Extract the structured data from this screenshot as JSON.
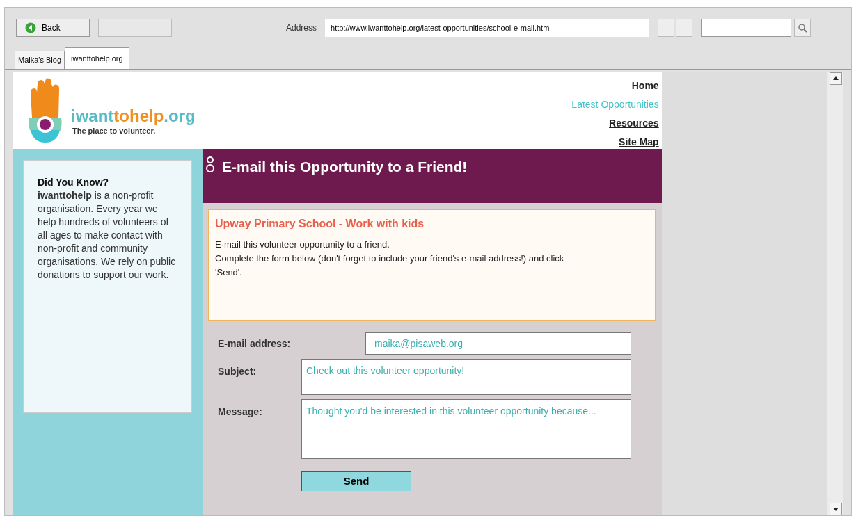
{
  "toolbar": {
    "back_button": "Back",
    "address_label": "Address",
    "address": "http://www.iwanttohelp.org/latest-opportunities/school-e-mail.html"
  },
  "tabs": [
    {
      "label": "Maika's Blog",
      "selected": false
    },
    {
      "label": "iwanttohelp.org",
      "selected": true
    }
  ],
  "site": {
    "logo_name_parts": [
      "iwant",
      "tohelp",
      ".org"
    ],
    "tagline": "The place to volunteer."
  },
  "nav": [
    {
      "label": "Home",
      "selected": false
    },
    {
      "label": "Latest Opportunities",
      "selected": true
    },
    {
      "label": "Resources",
      "selected": false
    },
    {
      "label": "Site Map",
      "selected": false
    }
  ],
  "sidebar": {
    "title": "Did You Know?",
    "text": "**iwanttohelp** is a non-profit organisation. Every year we help hundreds of volunteers of all ages to make contact with non-profit and community organisations. We rely on public donations to support our work."
  },
  "banner": {
    "title": "E-mail this Opportunity to a Friend!"
  },
  "opportunity": {
    "title": "Upway Primary School - Work with kids",
    "lines": [
      "E-mail this volunteer opportunity to a friend.",
      "Complete the form below (don't forget to include your friend's e-mail address!) and click 'Send'."
    ]
  },
  "form": {
    "fields": [
      {
        "label": "E-mail address:",
        "value": "maika@pisaweb.org",
        "kind": "line"
      },
      {
        "label": "Subject:",
        "value": "Check out this volunteer opportunity!",
        "kind": "box"
      },
      {
        "label": "Message:",
        "value": "Thought you'd be interested in this volunteer opportunity because...",
        "kind": "area"
      }
    ],
    "submit": "Send"
  }
}
